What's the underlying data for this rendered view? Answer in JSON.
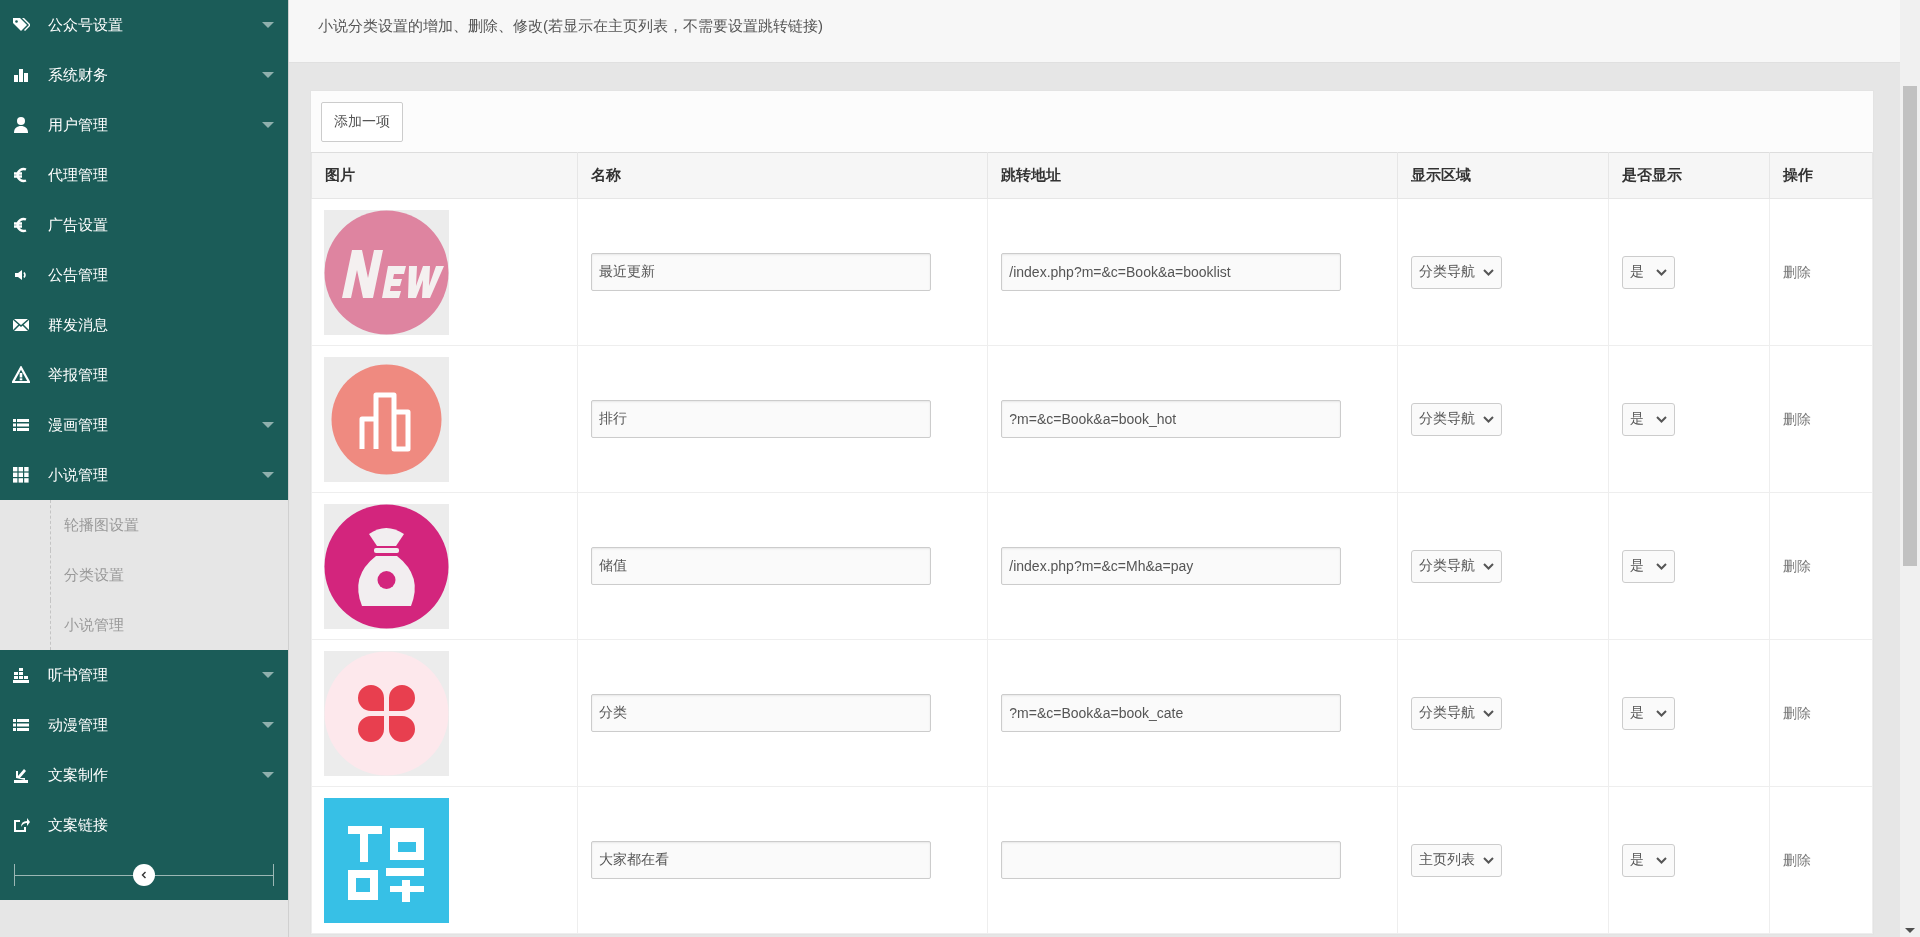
{
  "sidebar": {
    "items": [
      {
        "label": "公众号设置",
        "kind": "menu"
      },
      {
        "label": "系统财务",
        "kind": "menu"
      },
      {
        "label": "用户管理",
        "kind": "menu"
      },
      {
        "label": "代理管理",
        "kind": "link"
      },
      {
        "label": "广告设置",
        "kind": "link"
      },
      {
        "label": "公告管理",
        "kind": "link"
      },
      {
        "label": "群发消息",
        "kind": "link"
      },
      {
        "label": "举报管理",
        "kind": "link"
      },
      {
        "label": "漫画管理",
        "kind": "menu"
      },
      {
        "label": "小说管理",
        "kind": "menu",
        "children": [
          {
            "label": "轮播图设置"
          },
          {
            "label": "分类设置"
          },
          {
            "label": "小说管理"
          }
        ]
      },
      {
        "label": "听书管理",
        "kind": "menu"
      },
      {
        "label": "动漫管理",
        "kind": "menu"
      },
      {
        "label": "文案制作",
        "kind": "menu"
      },
      {
        "label": "文案链接",
        "kind": "link"
      }
    ]
  },
  "page": {
    "subtitle": "小说分类设置的增加、删除、修改(若显示在主页列表，不需要设置跳转链接)"
  },
  "toolbar": {
    "add_button": "添加一项"
  },
  "table": {
    "columns": [
      "图片",
      "名称",
      "跳转地址",
      "显示区域",
      "是否显示",
      "操作"
    ],
    "rows": [
      {
        "name": "最近更新",
        "url": "/index.php?m=&c=Book&a=booklist",
        "area": "分类导航",
        "visible": "是",
        "action": "删除"
      },
      {
        "name": "排行",
        "url": "?m=&c=Book&a=book_hot",
        "area": "分类导航",
        "visible": "是",
        "action": "删除"
      },
      {
        "name": "储值",
        "url": "/index.php?m=&c=Mh&a=pay",
        "area": "分类导航",
        "visible": "是",
        "action": "删除"
      },
      {
        "name": "分类",
        "url": "?m=&c=Book&a=book_cate",
        "area": "分类导航",
        "visible": "是",
        "action": "删除"
      },
      {
        "name": "大家都在看",
        "area": "主页列表",
        "visible": "是",
        "action": "删除"
      }
    ]
  }
}
